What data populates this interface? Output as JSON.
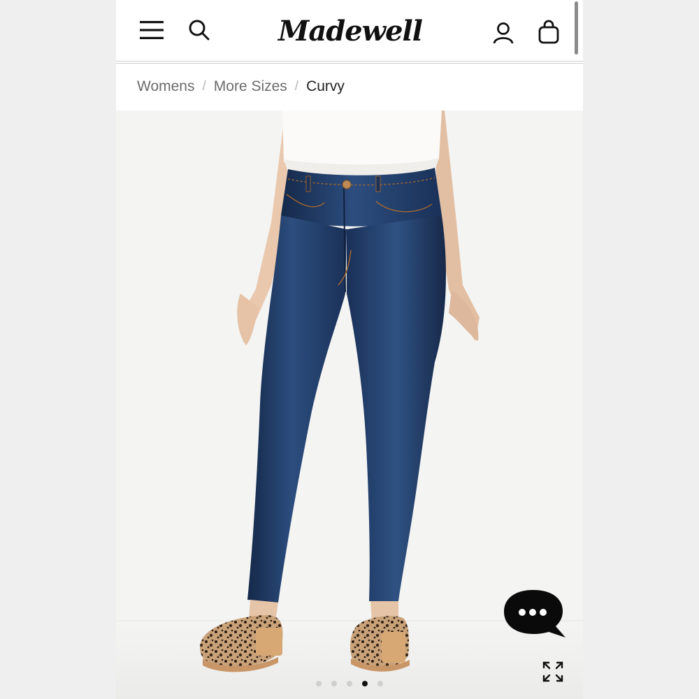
{
  "brand": {
    "logo_text": "Madewell"
  },
  "header": {
    "menu_icon": "hamburger-menu-icon",
    "search_icon": "search-icon",
    "account_icon": "user-account-icon",
    "bag_icon": "shopping-bag-icon"
  },
  "breadcrumb": {
    "items": [
      {
        "label": "Womens"
      },
      {
        "label": "More Sizes"
      },
      {
        "label": "Curvy"
      }
    ],
    "separator": "/"
  },
  "gallery": {
    "image_count": 5,
    "active_index": 3,
    "chat_icon": "chat-bubble-icon",
    "expand_icon": "expand-icon"
  },
  "colors": {
    "text_primary": "#111111",
    "text_muted": "#6b6b6b",
    "denim": "#1f3a63",
    "accent": "#111111"
  }
}
